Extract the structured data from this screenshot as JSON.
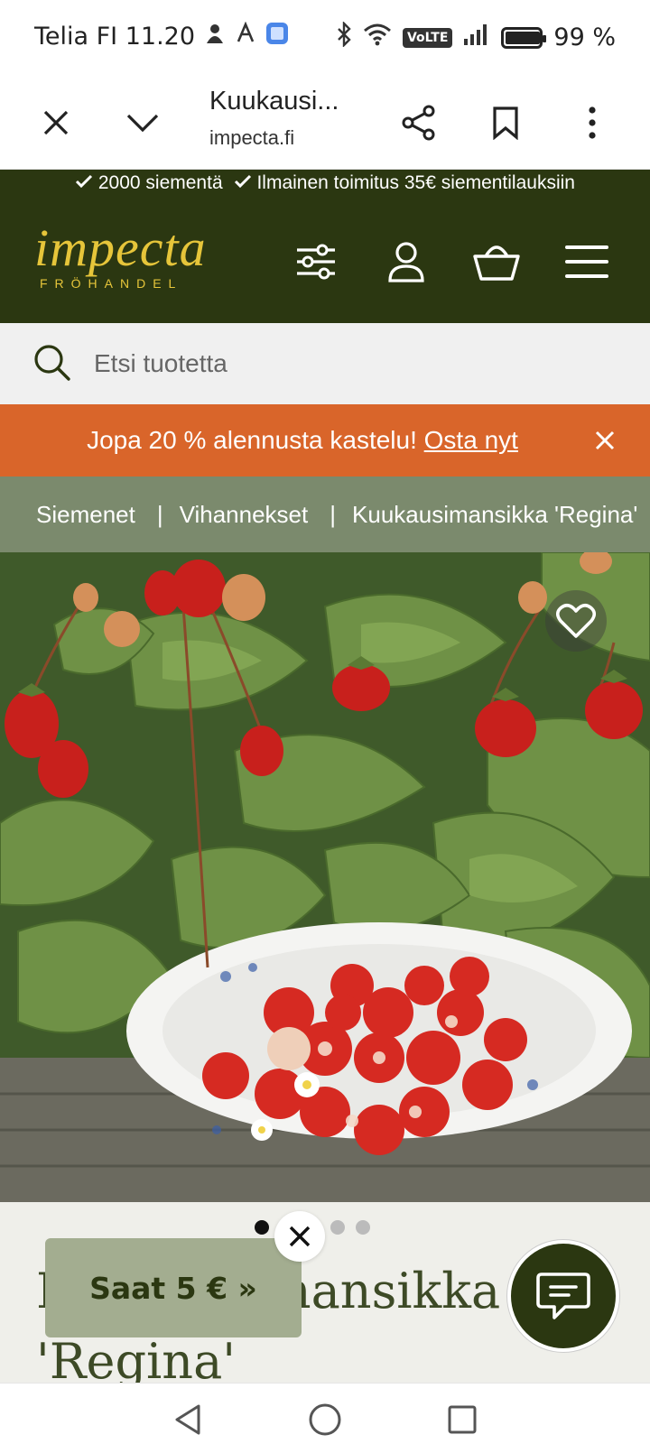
{
  "status_bar": {
    "carrier_time": "Telia FI 11.20",
    "volte": "VoLTE",
    "battery": "99 %",
    "battery_level": 0.99
  },
  "browser": {
    "page_title": "Kuukausi...",
    "url": "impecta.fi"
  },
  "promo_strip": {
    "item1": "2000 siementä",
    "item2": "Ilmainen toimitus 35€ siementilauksiin"
  },
  "header": {
    "logo_main": "impecta",
    "logo_sub": "FRÖHANDEL",
    "brand_color": "#2b3711",
    "logo_color": "#e6c53a"
  },
  "search": {
    "placeholder": "Etsi tuotetta"
  },
  "discount_banner": {
    "text": "Jopa 20 % alennusta kastelu!",
    "link": "Osta nyt",
    "color": "#d9652a"
  },
  "breadcrumb": {
    "items": [
      "Siemenet",
      "Vihannekset",
      "Kuukausimansikka 'Regina'"
    ],
    "separator": "|"
  },
  "carousel": {
    "total": 5,
    "active": 1
  },
  "product": {
    "title": "Kuukausimansikka 'Regina'"
  },
  "voucher": {
    "label": "Saat 5 € »"
  }
}
